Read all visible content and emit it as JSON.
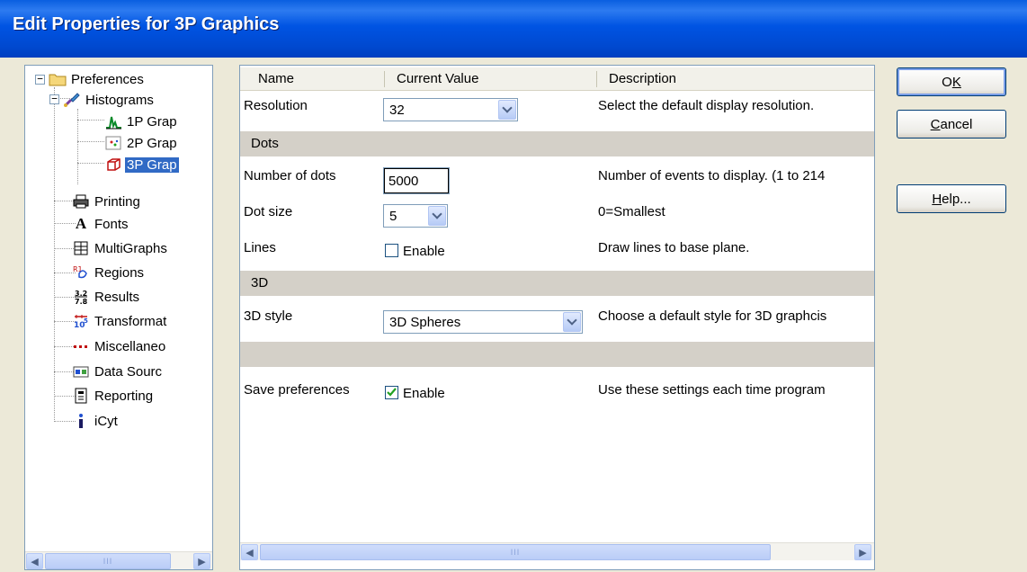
{
  "window": {
    "title": "Edit Properties for 3P Graphics"
  },
  "tree": {
    "root": {
      "label": "Preferences",
      "icon": "folder-icon",
      "expanded": true
    },
    "histograms": {
      "label": "Histograms",
      "icon": "brush-icon",
      "expanded": true
    },
    "children_hist": [
      {
        "label": "1P Grap",
        "icon": "histogram-1p-icon",
        "selected": false
      },
      {
        "label": "2P Grap",
        "icon": "histogram-2p-icon",
        "selected": false
      },
      {
        "label": "3P Grap",
        "icon": "cube-3p-icon",
        "selected": true
      }
    ],
    "items": [
      {
        "label": "Printing",
        "icon": "printer-icon"
      },
      {
        "label": "Fonts",
        "icon": "font-a-icon"
      },
      {
        "label": "MultiGraphs",
        "icon": "grid-icon"
      },
      {
        "label": "Regions",
        "icon": "regions-icon"
      },
      {
        "label": "Results",
        "icon": "results-icon"
      },
      {
        "label": "Transformat",
        "icon": "transform-icon"
      },
      {
        "label": "Miscellaneo",
        "icon": "dots-icon"
      },
      {
        "label": "Data Sourc",
        "icon": "data-source-icon"
      },
      {
        "label": "Reporting",
        "icon": "report-icon"
      },
      {
        "label": "iCyt",
        "icon": "info-icon"
      }
    ]
  },
  "grid": {
    "headers": {
      "name": "Name",
      "value": "Current Value",
      "description": "Description"
    },
    "resolution": {
      "name": "Resolution",
      "value": "32",
      "description": "Select the default display resolution."
    },
    "section_dots": "Dots",
    "number_of_dots": {
      "name": "Number of dots",
      "value": "5000",
      "description": "Number of events to display. (1 to 214"
    },
    "dot_size": {
      "name": "Dot size",
      "value": "5",
      "description": "0=Smallest"
    },
    "lines": {
      "name": "Lines",
      "checkbox_label": "Enable",
      "checked": false,
      "description": "Draw lines to base plane."
    },
    "section_3d": "3D",
    "style_3d": {
      "name": "3D style",
      "value": "3D Spheres",
      "description": "Choose a default style for 3D graphcis"
    },
    "save_prefs": {
      "name": "Save preferences",
      "checkbox_label": "Enable",
      "checked": true,
      "description": "Use these settings each time program"
    }
  },
  "buttons": {
    "ok": {
      "label_pre": "O",
      "label_u": "K",
      "label_post": ""
    },
    "cancel": {
      "label_pre": "",
      "label_u": "C",
      "label_post": "ancel"
    },
    "help": {
      "label_pre": "",
      "label_u": "H",
      "label_post": "elp..."
    }
  },
  "scrollbar": {
    "grip": "III"
  }
}
